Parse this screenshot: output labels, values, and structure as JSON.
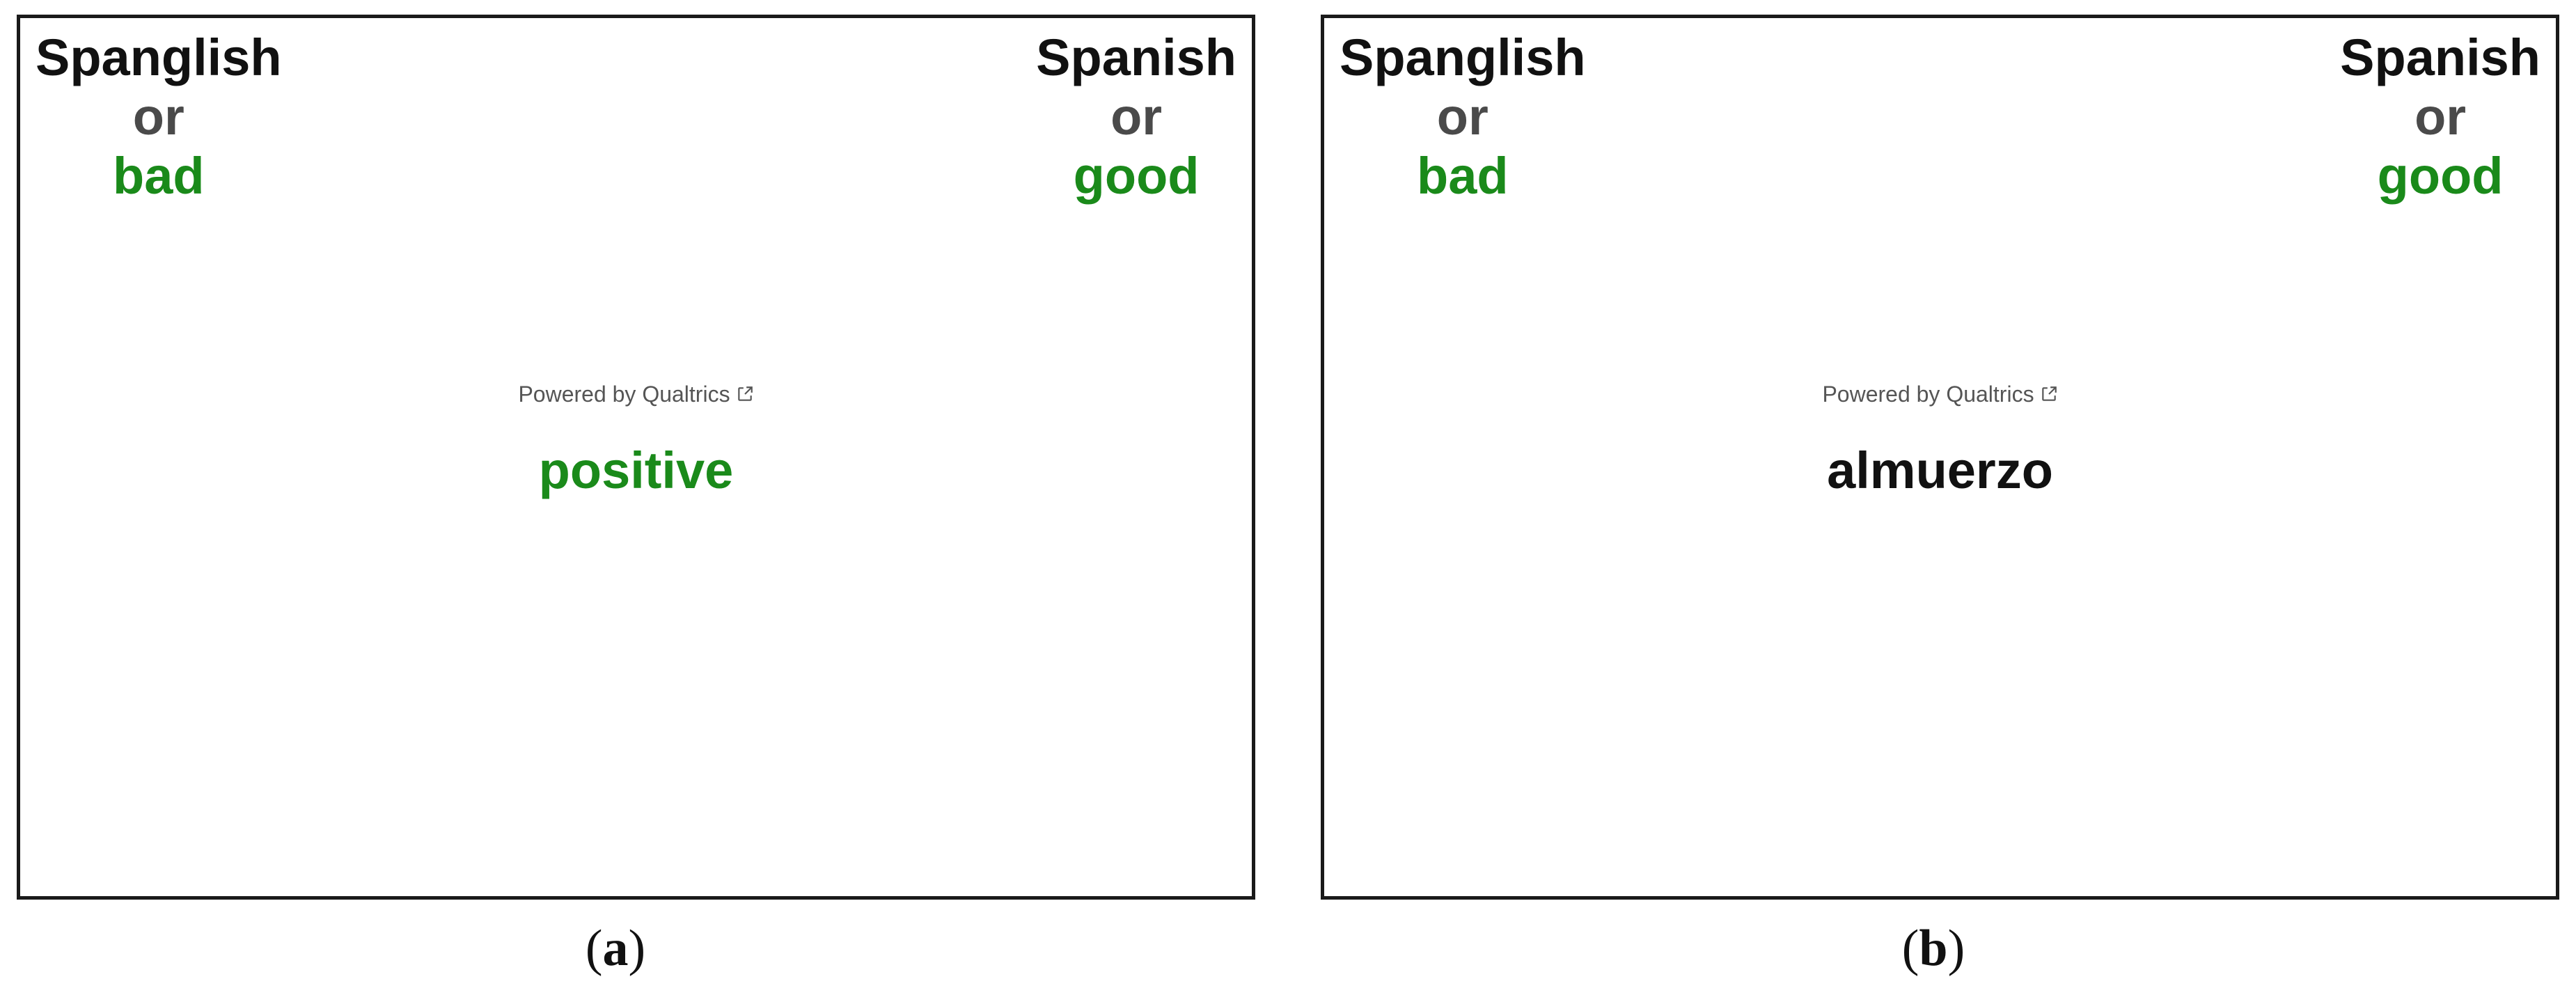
{
  "panels": [
    {
      "left_category": {
        "label": "Spanglish",
        "conjunction": "or",
        "attribute": "bad",
        "attribute_color": "#1a8a1a"
      },
      "right_category": {
        "label": "Spanish",
        "conjunction": "or",
        "attribute": "good",
        "attribute_color": "#1a8a1a"
      },
      "powered_by": "Powered by Qualtrics",
      "powered_icon": "external-link-icon",
      "stimulus": {
        "text": "positive",
        "color": "#1a8a1a"
      },
      "caption_letter": "a"
    },
    {
      "left_category": {
        "label": "Spanglish",
        "conjunction": "or",
        "attribute": "bad",
        "attribute_color": "#1a8a1a"
      },
      "right_category": {
        "label": "Spanish",
        "conjunction": "or",
        "attribute": "good",
        "attribute_color": "#1a8a1a"
      },
      "powered_by": "Powered by Qualtrics",
      "powered_icon": "external-link-icon",
      "stimulus": {
        "text": "almuerzo",
        "color": "#111111"
      },
      "caption_letter": "b"
    }
  ]
}
